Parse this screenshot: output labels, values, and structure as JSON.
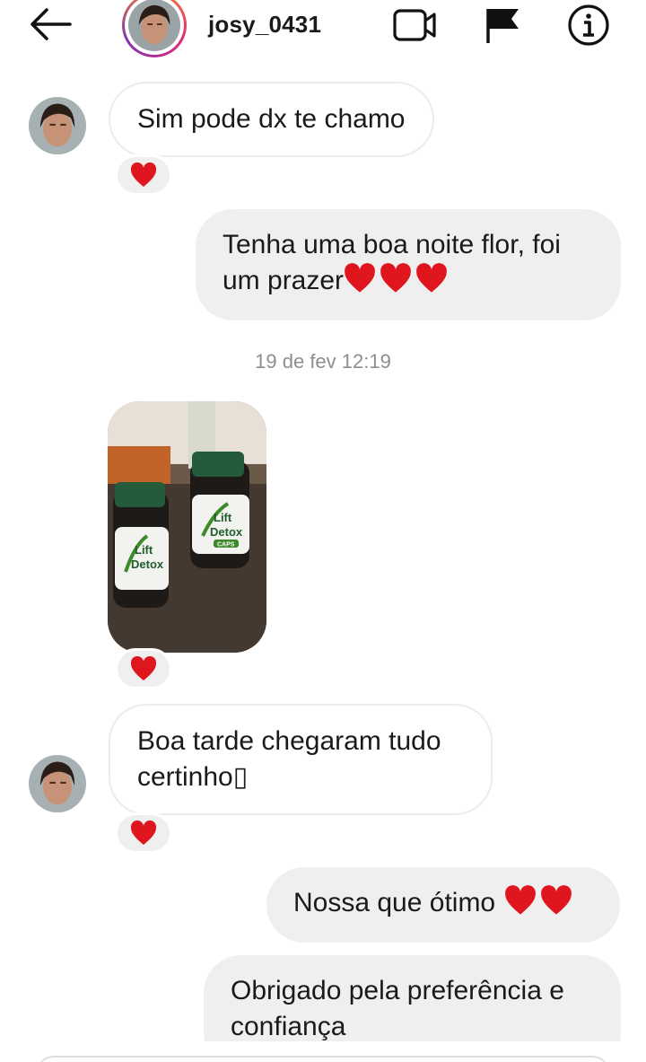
{
  "header": {
    "username": "josy_0431",
    "icons": [
      "back-arrow-icon",
      "video-call-icon",
      "flag-icon",
      "info-icon"
    ]
  },
  "messages": {
    "m1": {
      "text": "Sim pode dx te chamo",
      "reaction": "heart"
    },
    "m2": {
      "line1": "Tenha uma boa noite flor, foi",
      "line2": "um prazer"
    },
    "timestamp": "19 de fev 12:19",
    "photo": {
      "label_brand": "Lift",
      "label_name": "Detox",
      "label_caps": "CAPS",
      "reaction": "heart"
    },
    "m3": {
      "line1": "Boa tarde chegaram tudo",
      "line2": "certinho▯",
      "reaction": "heart"
    },
    "m4": {
      "text": "Nossa que ótimo"
    },
    "m5": {
      "line1": "Obrigado pela preferência e",
      "line2": "confiança"
    }
  },
  "colors": {
    "heart": "#e0161f",
    "outgoing_bubble": "#efefef",
    "timestamp": "#8e8e8e"
  }
}
